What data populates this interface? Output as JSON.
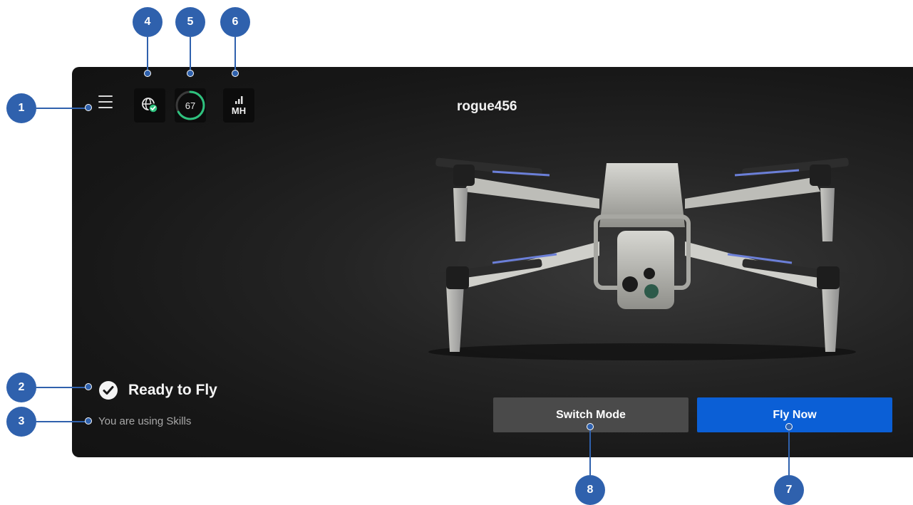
{
  "app": {
    "drone_name": "rogue456",
    "status_title": "Ready to Fly",
    "status_subtitle": "You are using Skills"
  },
  "top_bar": {
    "menu_icon": "hamburger-menu-icon",
    "connectivity_icon": "globe-check-icon",
    "battery_percent": "67",
    "battery_level": 0.67,
    "signal_label": "MH",
    "signal_icon": "signal-bars-icon"
  },
  "buttons": {
    "switch_mode": "Switch Mode",
    "fly_now": "Fly Now"
  },
  "callouts": [
    "1",
    "2",
    "3",
    "4",
    "5",
    "6",
    "7",
    "8"
  ],
  "colors": {
    "accent_blue": "#0b5fd6",
    "callout_blue": "#2f61ad",
    "ok_green": "#2ec27e",
    "screen_bg": "#1a1a1a"
  }
}
